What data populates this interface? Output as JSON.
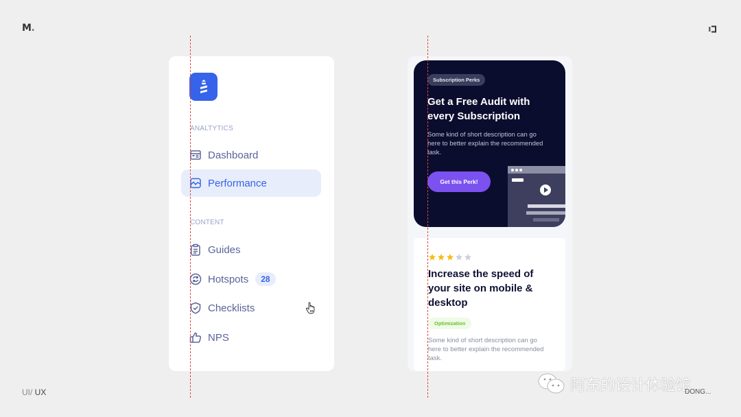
{
  "frame": {
    "brand_logo": "M",
    "brand_logo_dot": ".",
    "footer_label_light": "UI/",
    "footer_label_strong": " UX",
    "watermark_text": "阿东的设计体验馆",
    "watermark_sub": "DONG..."
  },
  "sidebar": {
    "logo_icon": "lighthouse-icon",
    "sections": [
      {
        "label": "ANALTYTICS",
        "items": [
          {
            "label": "Dashboard",
            "icon": "dashboard-icon",
            "active": false
          },
          {
            "label": "Performance",
            "icon": "chart-line-icon",
            "active": true
          }
        ]
      },
      {
        "label": "CONTENT",
        "items": [
          {
            "label": "Guides",
            "icon": "clipboard-icon",
            "active": false
          },
          {
            "label": "Hotspots",
            "icon": "refresh-circle-icon",
            "active": false,
            "badge": "28"
          },
          {
            "label": "Checklists",
            "icon": "shield-check-icon",
            "active": false
          },
          {
            "label": "NPS",
            "icon": "thumbs-up-icon",
            "active": false
          }
        ]
      }
    ],
    "colors": {
      "accent": "#3563e9",
      "active_bg": "#e8edfb",
      "text": "#5a6398",
      "section_label": "#9aa3c7"
    }
  },
  "promo_card": {
    "chip": "Subscription Perks",
    "title": "Get a Free Audit with every Subscription",
    "description": "Some kind of short description can go here to better explain the recommended task.",
    "button_label": "Get this Perk!",
    "colors": {
      "background": "#0b0d2e",
      "button": "#7b52f0"
    }
  },
  "task_card": {
    "rating": 3,
    "rating_max": 5,
    "title": "Increase the speed of your site on mobile & desktop",
    "tag": "Optimization",
    "description": "Some kind of short description can go here to better explain the recommended task.",
    "colors": {
      "star_on": "#f6bd16",
      "star_off": "#cdd0da",
      "tag_text": "#6cc12f",
      "tag_bg": "#effbe6"
    }
  }
}
